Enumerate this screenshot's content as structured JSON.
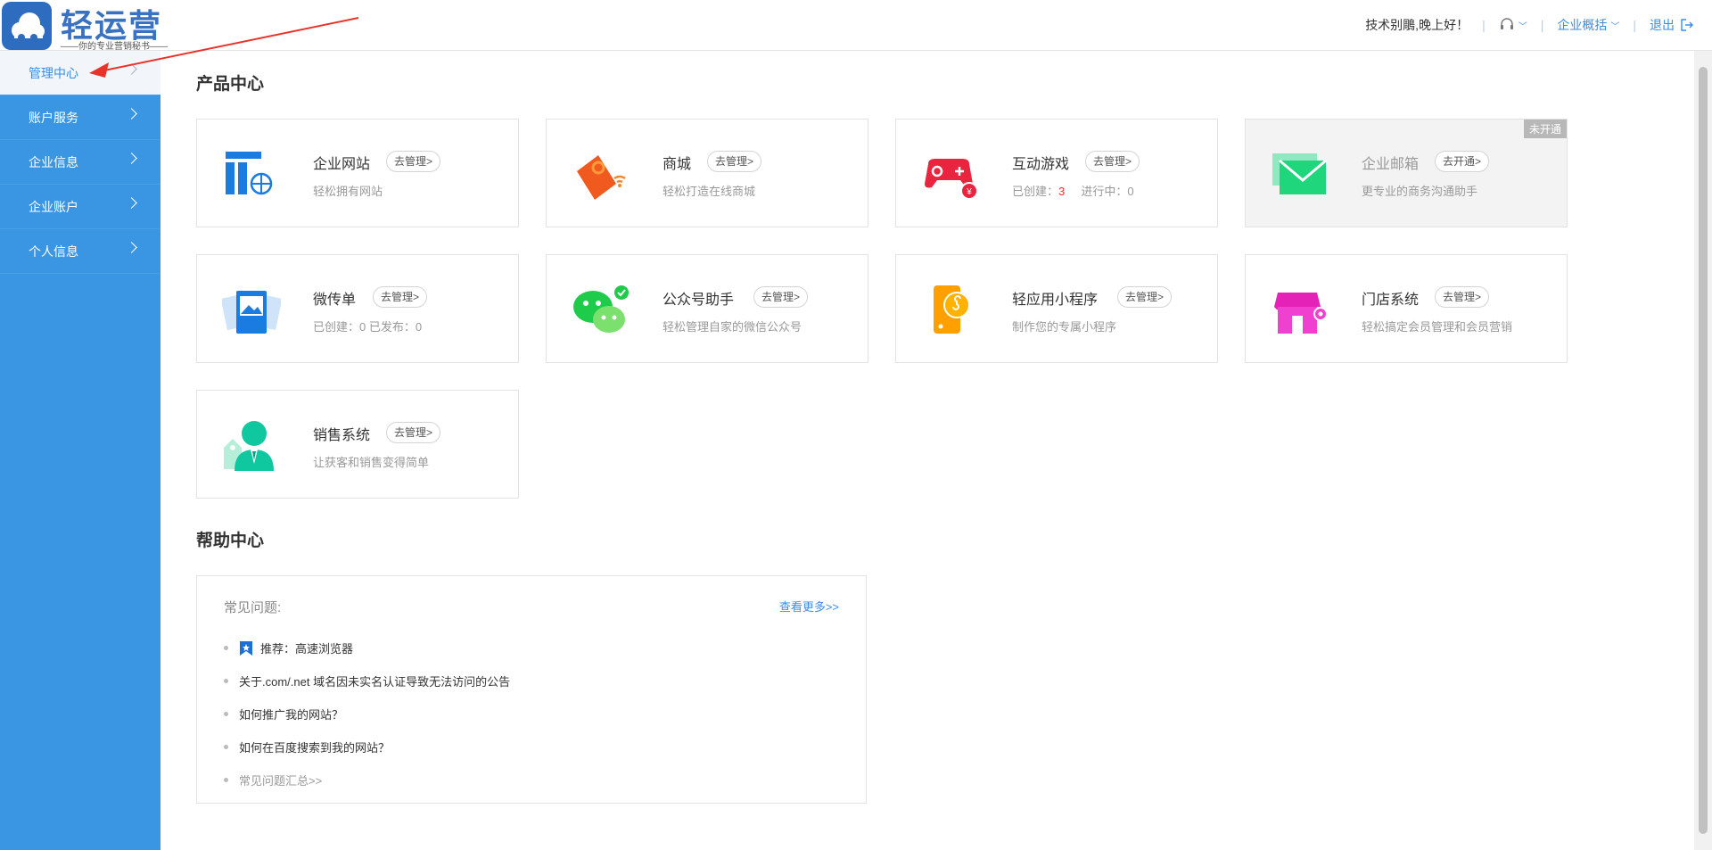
{
  "brand": {
    "name": "轻运营",
    "tagline": "——你的专业营销秘书——"
  },
  "header": {
    "greeting": "技术别鵰,晚上好！",
    "overview": "企业概括",
    "logout": "退出"
  },
  "sidebar": {
    "items": [
      {
        "label": "管理中心"
      },
      {
        "label": "账户服务"
      },
      {
        "label": "企业信息"
      },
      {
        "label": "企业账户"
      },
      {
        "label": "个人信息"
      }
    ]
  },
  "product_center": {
    "title": "产品中心",
    "cards": [
      {
        "name": "企业网站",
        "btn": "去管理>",
        "desc": "轻松拥有网站"
      },
      {
        "name": "商城",
        "btn": "去管理>",
        "desc": "轻松打造在线商城"
      },
      {
        "name": "互动游戏",
        "btn": "去管理>",
        "created_label": "已创建：",
        "created_value": "3",
        "running_label": "进行中：0"
      },
      {
        "name": "企业邮箱",
        "btn": "去开通>",
        "desc": "更专业的商务沟通助手",
        "badge": "未开通"
      },
      {
        "name": "微传单",
        "btn": "去管理>",
        "desc": "已创建：0    已发布：0"
      },
      {
        "name": "公众号助手",
        "btn": "去管理>",
        "desc": "轻松管理自家的微信公众号"
      },
      {
        "name": "轻应用小程序",
        "btn": "去管理>",
        "desc": "制作您的专属小程序"
      },
      {
        "name": "门店系统",
        "btn": "去管理>",
        "desc": "轻松搞定会员管理和会员营销"
      },
      {
        "name": "销售系统",
        "btn": "去管理>",
        "desc": "让获客和销售变得简单"
      }
    ]
  },
  "help_center": {
    "title": "帮助中心",
    "faq_label": "常见问题:",
    "more": "查看更多>>",
    "items": [
      "推荐：高速浏览器",
      "关于.com/.net 域名因未实名认证导致无法访问的公告",
      "如何推广我的网站？",
      "如何在百度搜索到我的网站？",
      "常见问题汇总>>"
    ]
  },
  "colors": {
    "sidebar": "#3a95e2",
    "accent": "#3a8ee6",
    "annotation": "#e8332a"
  }
}
